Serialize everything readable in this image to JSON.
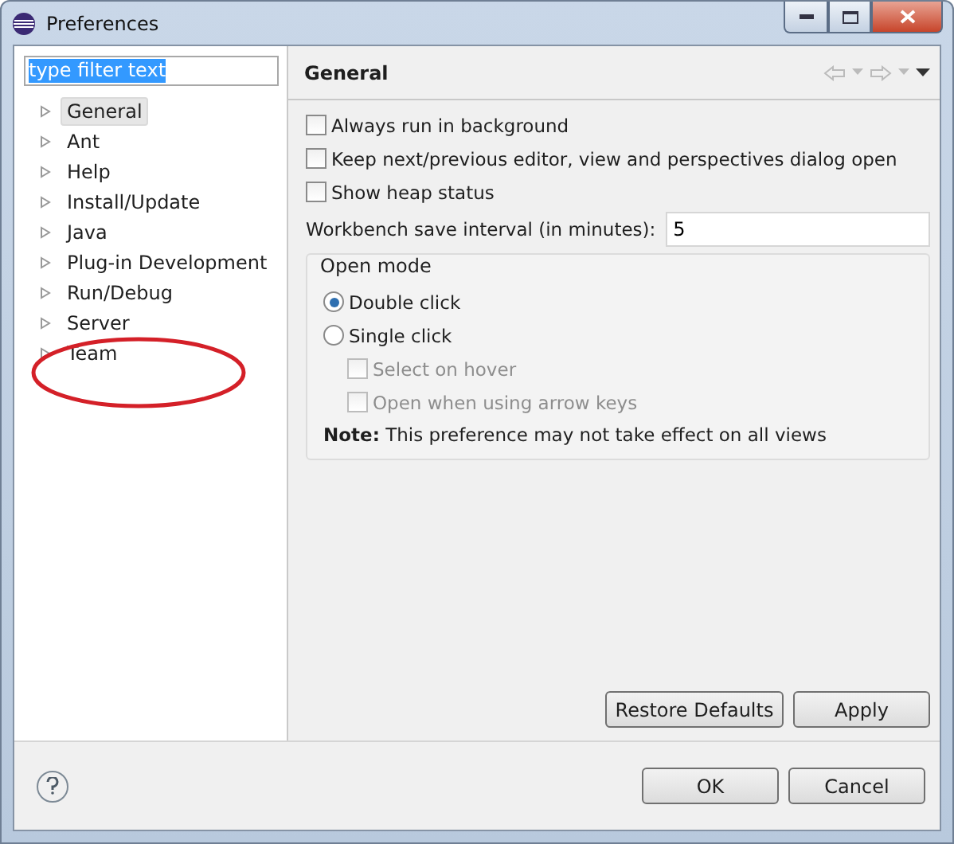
{
  "window": {
    "title": "Preferences"
  },
  "filter": {
    "value": "type filter text"
  },
  "tree": [
    {
      "label": "General",
      "selected": true,
      "expanded": false
    },
    {
      "label": "Ant",
      "selected": false,
      "expanded": false
    },
    {
      "label": "Help",
      "selected": false,
      "expanded": false
    },
    {
      "label": "Install/Update",
      "selected": false,
      "expanded": false
    },
    {
      "label": "Java",
      "selected": false,
      "expanded": false
    },
    {
      "label": "Plug-in Development",
      "selected": false,
      "expanded": false
    },
    {
      "label": "Run/Debug",
      "selected": false,
      "expanded": false
    },
    {
      "label": "Server",
      "selected": false,
      "expanded": false
    },
    {
      "label": "Team",
      "selected": false,
      "expanded": false
    }
  ],
  "page": {
    "title": "General",
    "options": [
      {
        "label": "Always run in background",
        "checked": false
      },
      {
        "label": "Keep next/previous editor, view and perspectives dialog open",
        "checked": false
      },
      {
        "label": "Show heap status",
        "checked": false
      }
    ],
    "save_interval": {
      "label": "Workbench save interval (in minutes):",
      "value": "5"
    },
    "open_mode": {
      "title": "Open mode",
      "choices": [
        {
          "label": "Double click",
          "selected": true
        },
        {
          "label": "Single click",
          "selected": false
        }
      ],
      "sub_options": [
        {
          "label": "Select on hover",
          "checked": false,
          "disabled": true
        },
        {
          "label": "Open when using arrow keys",
          "checked": false,
          "disabled": true
        }
      ]
    },
    "note": "**Note:** This preference may not take effect on all views",
    "buttons": [
      "Restore Defaults",
      "Apply"
    ]
  },
  "annotation": {
    "kind": "ellipse",
    "color": "#d42028"
  },
  "buttons": [
    "OK",
    "Cancel"
  ]
}
